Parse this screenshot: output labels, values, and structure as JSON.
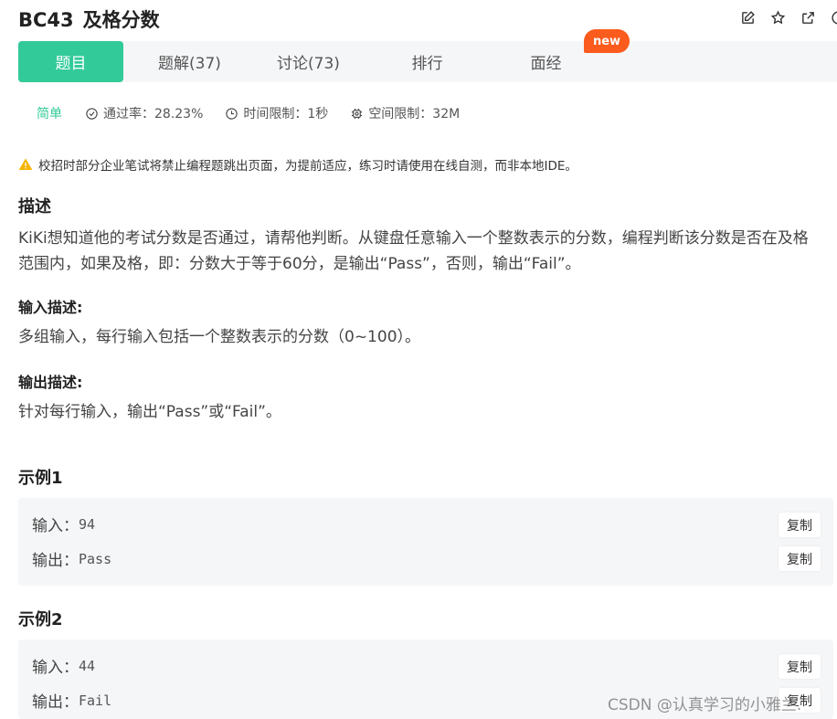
{
  "problem": {
    "code": "BC43",
    "name": "及格分数"
  },
  "tabs": [
    {
      "label": "题目"
    },
    {
      "label": "题解(37)"
    },
    {
      "label": "讨论(73)"
    },
    {
      "label": "排行"
    },
    {
      "label": "面经"
    }
  ],
  "badge_new": "new",
  "meta": {
    "level": "简单",
    "pass_rate": "通过率：28.23%",
    "time_limit": "时间限制：1秒",
    "space_limit": "空间限制：32M"
  },
  "notice": "校招时部分企业笔试将禁止编程题跳出页面，为提前适应，练习时请使用在线自测，而非本地IDE。",
  "description": {
    "heading": "描述",
    "line1": "KiKi想知道他的考试分数是否通过，请帮他判断。从键盘任意输入一个整数表示的分数，编程判断该分数是否在及格",
    "line2": "范围内，如果及格，即：分数大于等于60分，是输出“Pass”，否则，输出“Fail”。"
  },
  "input_desc": {
    "heading": "输入描述:",
    "text": "多组输入，每行输入包括一个整数表示的分数（0~100）。"
  },
  "output_desc": {
    "heading": "输出描述:",
    "text": "针对每行输入，输出“Pass”或“Fail”。"
  },
  "examples": [
    {
      "title": "示例1",
      "input_label": "输入：",
      "input": "94",
      "output_label": "输出：",
      "output": "Pass",
      "copy": "复制"
    },
    {
      "title": "示例2",
      "input_label": "输入：",
      "input": "44",
      "output_label": "输出：",
      "output": "Fail",
      "copy": "复制"
    }
  ],
  "watermark": "CSDN @认真学习的小雅兰.",
  "colors": {
    "accent": "#32ca99",
    "badge": "#fb5b1c",
    "warning": "#f5b400"
  }
}
